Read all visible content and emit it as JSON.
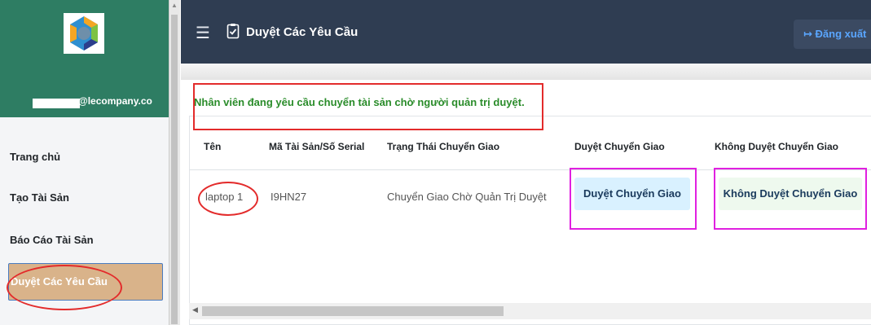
{
  "sidebar": {
    "email": "@lecompany.co",
    "items": [
      {
        "label": "Trang chủ"
      },
      {
        "label": "Tạo Tài Sản"
      },
      {
        "label": "Báo Cáo Tài Sản"
      },
      {
        "label": "Duyệt Các Yêu Cầu"
      }
    ]
  },
  "header": {
    "title": "Duyệt Các Yêu Cầu",
    "logout_label": "Đăng xuất"
  },
  "notice": "Nhân viên đang yêu cầu chuyển tài sản chờ người quản trị duyệt.",
  "table": {
    "columns": [
      "Tên",
      "Mã Tài Sản/Số Serial",
      "Trạng Thái Chuyển Giao",
      "Duyệt Chuyển Giao",
      "Không Duyệt Chuyển Giao"
    ],
    "rows": [
      {
        "name": "laptop 1",
        "serial": "I9HN27",
        "status": "Chuyển Giao Chờ Quản Trị Duyệt",
        "approve_label": "Duyệt Chuyển Giao",
        "reject_label": "Không Duyệt Chuyển Giao"
      }
    ]
  },
  "colors": {
    "sidebar_top": "#2e7d63",
    "header_bg": "#2f3d52",
    "notice_text": "#2a8c2a",
    "active_item": "#d9b38a",
    "approve_bg": "#d9f1ff",
    "reject_bg": "#eef9ee",
    "annotation_red": "#e32b2b",
    "annotation_magenta": "#e020e0"
  },
  "icons": {
    "menu": "hamburger-icon",
    "title": "clipboard-check-icon",
    "logout": "sign-out-icon"
  }
}
